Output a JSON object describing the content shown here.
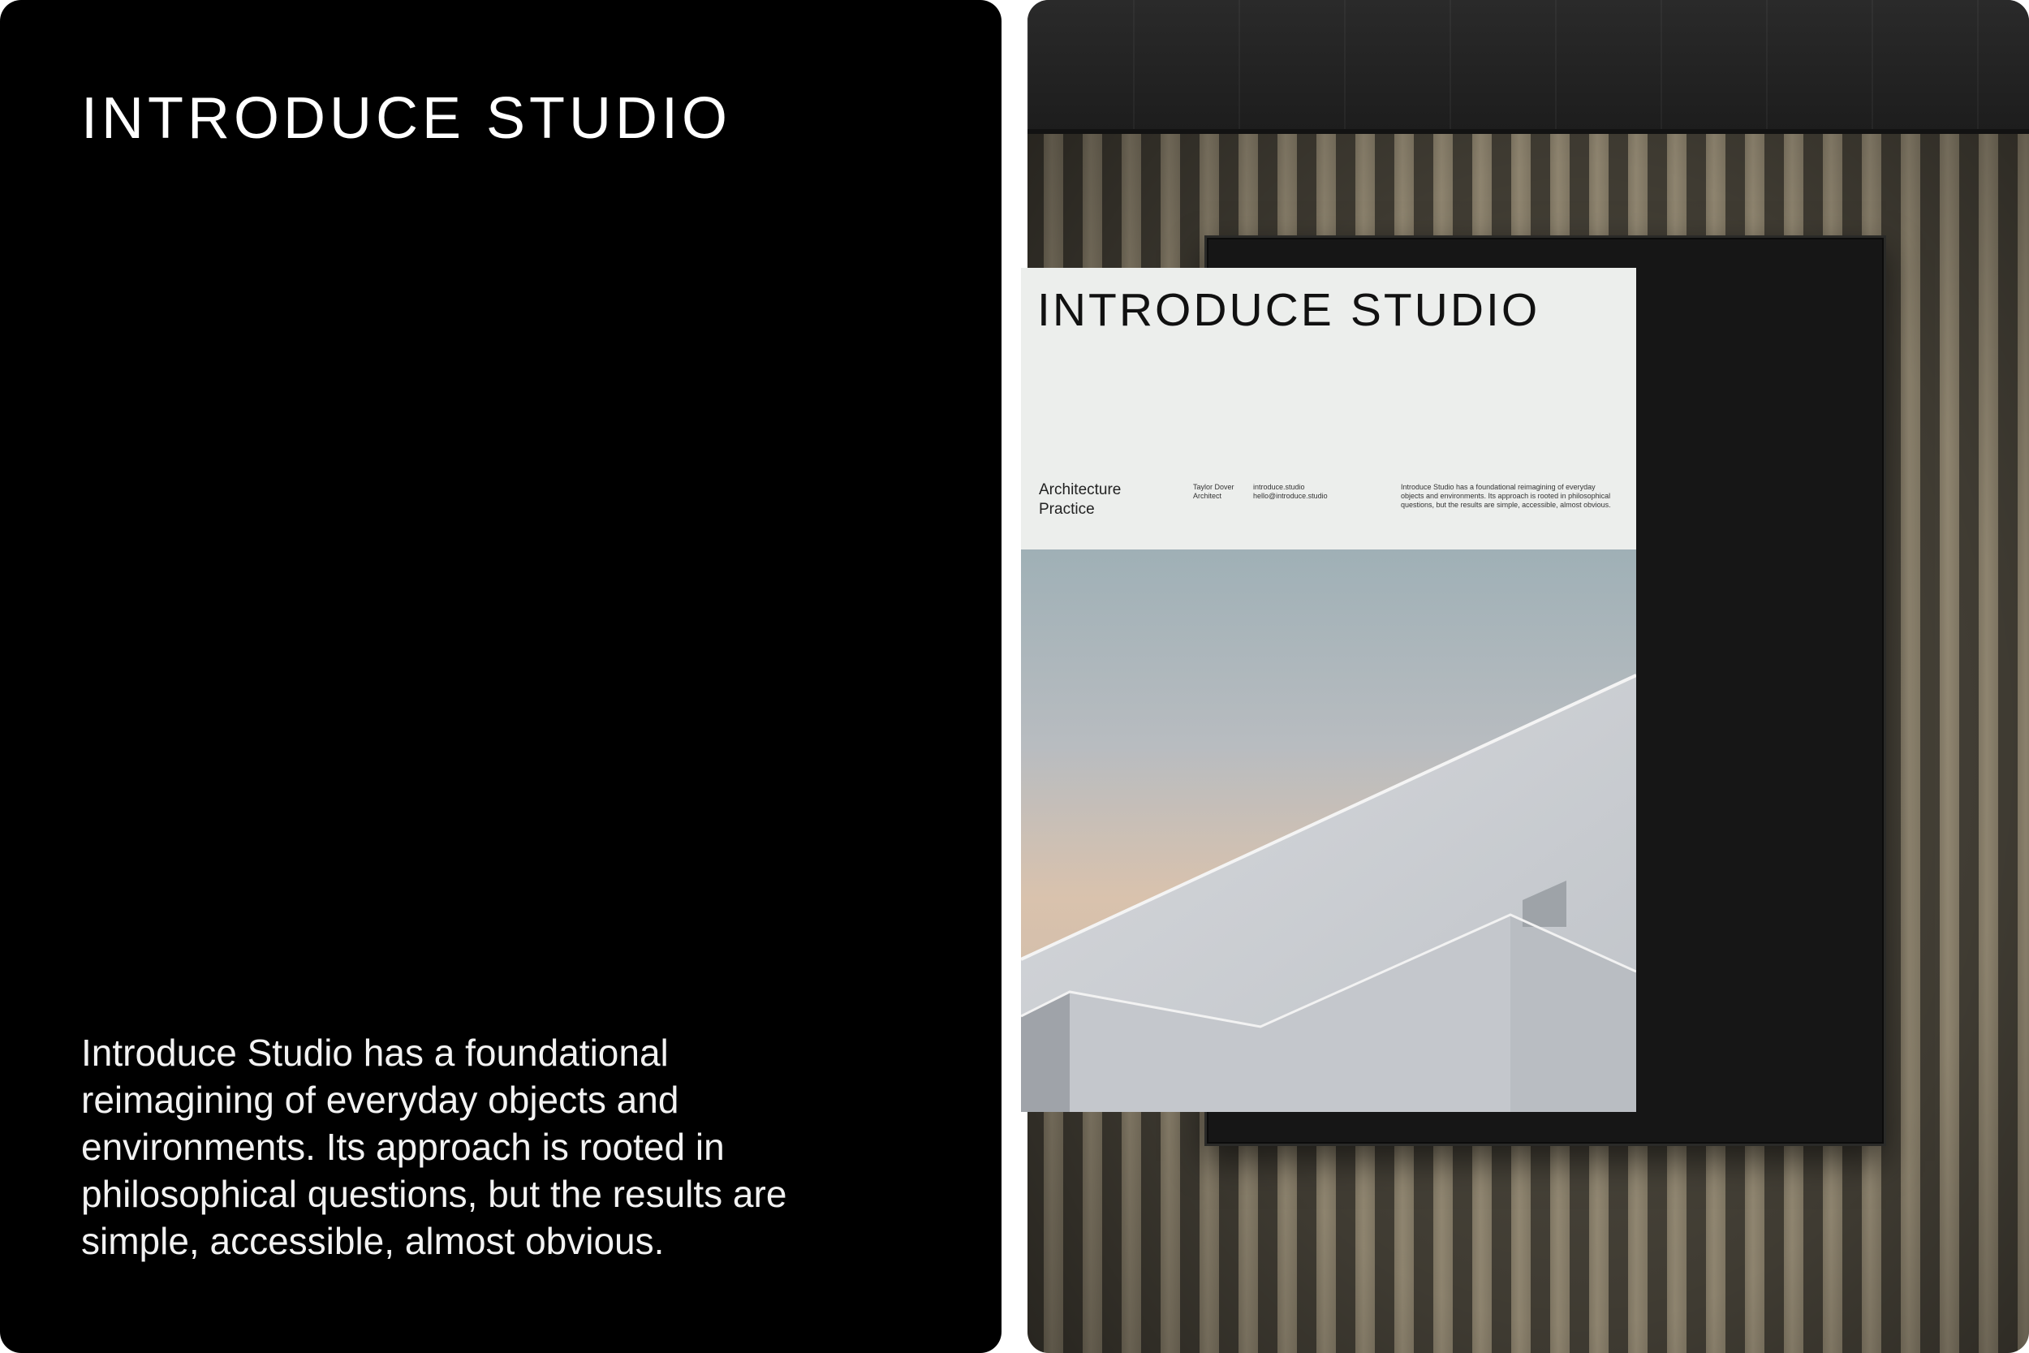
{
  "left_card": {
    "logo": {
      "first": "INTRODUCE",
      "second": "STUDIO"
    },
    "description": "Introduce Studio has a foundational reimagining of everyday objects and environments. Its approach is rooted in philosophical questions, but the results are simple, accessible, almost obvious."
  },
  "poster": {
    "logo": {
      "first": "INTRODUCE",
      "second": "STUDIO"
    },
    "title_line1": "Architecture",
    "title_line2": "Practice",
    "person_name": "Taylor Dover",
    "person_role": "Architect",
    "website": "introduce.studio",
    "email": "hello@introduce.studio",
    "blurb": "Introduce Studio has a foundational reimagining of everyday objects and environments. Its approach is rooted in philosophical questions, but the results are simple, accessible, almost obvious."
  },
  "colors": {
    "left_background": "#000000",
    "left_text": "#ffffff",
    "poster_background": "#eceeec",
    "wall_slats": "#7d7461"
  }
}
